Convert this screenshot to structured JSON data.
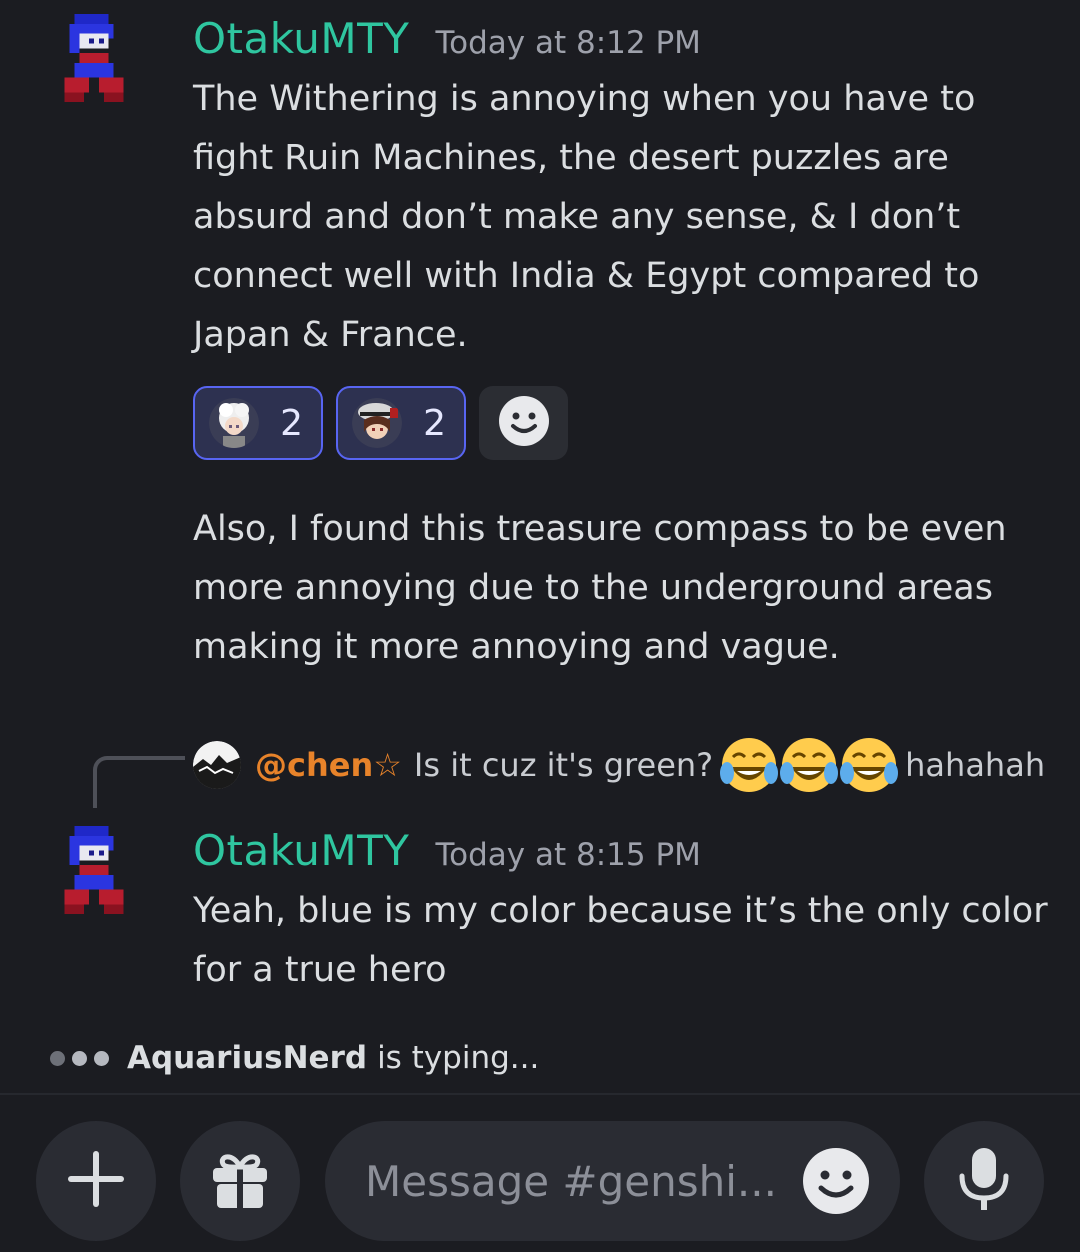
{
  "messages": [
    {
      "username": "OtakuMTY",
      "timestamp": "Today at 8:12 PM",
      "paragraphs": [
        "The Withering is annoying when you have to fight Ruin Machines, the desert puzzles are absurd and don’t make any sense, & I don’t connect well with India & Egypt compared to Japan & France.",
        "Also, I found this treasure compass to be even more annoying due to the underground areas making it more annoying and vague."
      ],
      "reactions": [
        {
          "emoji": "white-haired-character-emoji",
          "count": "2"
        },
        {
          "emoji": "hat-character-emoji",
          "count": "2"
        }
      ]
    },
    {
      "username": "OtakuMTY",
      "timestamp": "Today at 8:15 PM",
      "reply": {
        "user": "@chen☆",
        "text": "Is it cuz it's green?",
        "suffix": "hahahah"
      },
      "text": "Yeah, blue is my color because it’s the only color for a true hero"
    }
  ],
  "typing": {
    "name": "AquariusNerd",
    "text": "is typing..."
  },
  "composer": {
    "placeholder": "Message #genshi..."
  },
  "colors": {
    "background": "#1b1c21",
    "username": "#2fc6a0",
    "mention": "#e8832a",
    "reaction_border": "#5865f2"
  }
}
